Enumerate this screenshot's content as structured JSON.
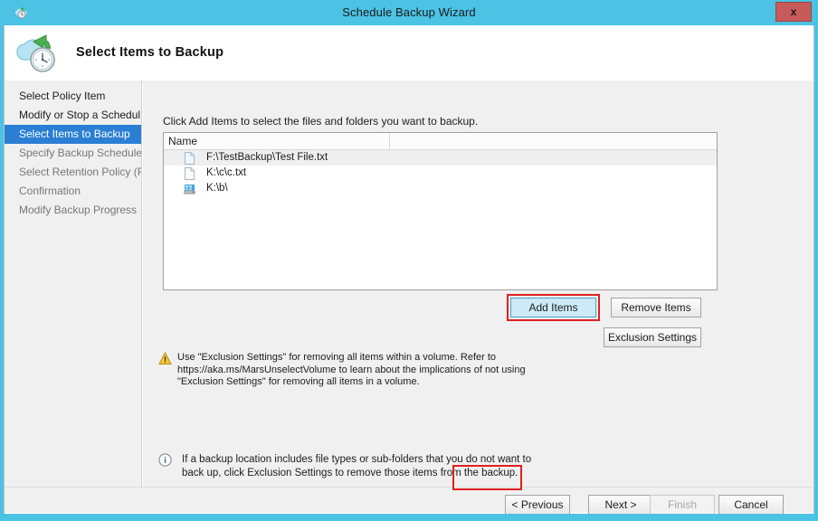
{
  "window": {
    "title": "Schedule Backup Wizard",
    "titlebar_icon": "cloud-clock-icon",
    "close_label": "x",
    "titlebar_color": "#4cc2e4"
  },
  "header": {
    "title": "Select Items to Backup",
    "icon": "cloud-backup-clock-icon"
  },
  "sidebar": {
    "items": [
      {
        "label": "Select Policy Item",
        "state": "done"
      },
      {
        "label": "Modify or Stop a Schedul...",
        "state": "done"
      },
      {
        "label": "Select Items to Backup",
        "state": "active"
      },
      {
        "label": "Specify Backup Schedule ...",
        "state": "pending"
      },
      {
        "label": "Select Retention Policy (F...",
        "state": "pending"
      },
      {
        "label": "Confirmation",
        "state": "pending"
      },
      {
        "label": "Modify Backup Progress",
        "state": "pending"
      }
    ],
    "active_color": "#2a7fd4"
  },
  "main": {
    "instruction": "Click Add Items to select the files and folders you want to backup.",
    "list": {
      "columns": [
        "Name",
        ""
      ],
      "rows": [
        {
          "name": "F:\\TestBackup\\Test File.txt",
          "icon": "file-icon",
          "selected": true
        },
        {
          "name": "K:\\c\\c.txt",
          "icon": "file-icon",
          "selected": false
        },
        {
          "name": "K:\\b\\",
          "icon": "drive-icon",
          "selected": false
        }
      ]
    },
    "buttons": {
      "add_items": "Add Items",
      "remove_items": "Remove Items",
      "exclusion_settings": "Exclusion Settings"
    },
    "warning": {
      "icon": "warning-triangle-icon",
      "text": "Use \"Exclusion Settings\" for removing all items within a volume. Refer to https://aka.ms/MarsUnselectVolume to learn about the implications of not using \"Exclusion Settings\" for removing all items in a volume."
    },
    "info": {
      "icon": "info-circle-icon",
      "text": "If a backup location includes file types or sub-folders that you do not want to back up, click Exclusion Settings to remove those items from the backup."
    }
  },
  "footer": {
    "previous": "< Previous",
    "next": "Next >",
    "finish": "Finish",
    "cancel": "Cancel"
  },
  "annotations": {
    "highlight_color": "#e02020",
    "highlighted": [
      "Add Items",
      "Next >"
    ]
  }
}
